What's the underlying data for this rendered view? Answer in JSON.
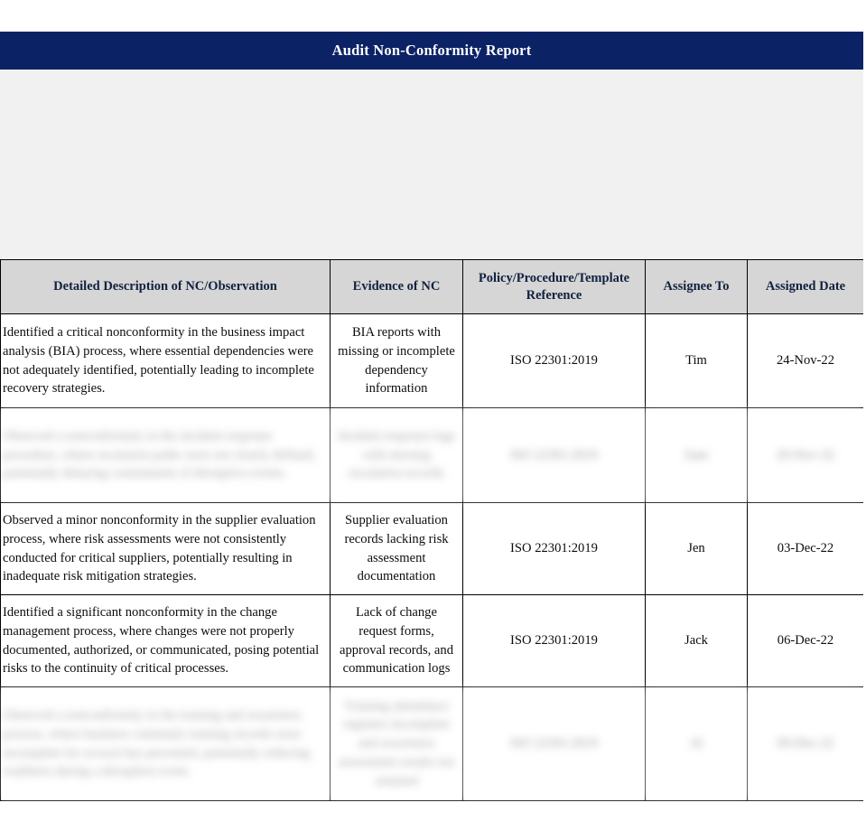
{
  "document": {
    "title": "Audit Non-Conformity Report",
    "banner_color": "#0b2265",
    "banner_text_color": "#ffffff",
    "header_fill": "#d6d6d6",
    "page_background": "#ffffff",
    "spacer_fill": "#f1f1f1"
  },
  "table": {
    "columns": [
      {
        "key": "description",
        "label": "Detailed Description of NC/Observation"
      },
      {
        "key": "evidence",
        "label": "Evidence of NC"
      },
      {
        "key": "policy",
        "label": "Policy/Procedure/Template Reference"
      },
      {
        "key": "assignee",
        "label": "Assignee To"
      },
      {
        "key": "assigned_date",
        "label": "Assigned Date"
      }
    ],
    "rows": [
      {
        "redacted": false,
        "description": "Identified a critical nonconformity in the business impact analysis (BIA) process, where essential dependencies were not adequately identified, potentially leading to incomplete recovery strategies.",
        "evidence": "BIA reports with missing or incomplete dependency information",
        "policy": "ISO 22301:2019",
        "assignee": "Tim",
        "assigned_date": "24-Nov-22"
      },
      {
        "redacted": true,
        "description": "Observed a nonconformity in the incident response procedure, where escalation paths were not clearly defined, potentially delaying containment of disruptive events.",
        "evidence": "Incident response logs with missing escalation records",
        "policy": "ISO 22301:2019",
        "assignee": "Sam",
        "assigned_date": "29-Nov-22"
      },
      {
        "redacted": false,
        "description": "Observed a minor nonconformity in the supplier evaluation process, where risk assessments were not consistently conducted for critical suppliers, potentially resulting in inadequate risk mitigation strategies.",
        "evidence": "Supplier evaluation records lacking risk assessment documentation",
        "policy": "ISO 22301:2019",
        "assignee": "Jen",
        "assigned_date": "03-Dec-22"
      },
      {
        "redacted": false,
        "description": "Identified a significant nonconformity in the change management process, where changes were not properly documented, authorized, or communicated, posing potential risks to the continuity of critical processes.",
        "evidence": "Lack of change request forms, approval records, and communication logs",
        "policy": "ISO 22301:2019",
        "assignee": "Jack",
        "assigned_date": "06-Dec-22"
      },
      {
        "redacted": true,
        "description": "Observed a nonconformity in the training and awareness process, where business continuity training records were incomplete for several key personnel, potentially reducing readiness during a disruption event.",
        "evidence": "Training attendance registers incomplete and awareness assessment results not retained",
        "policy": "ISO 22301:2019",
        "assignee": "Al",
        "assigned_date": "09-Dec-22"
      }
    ]
  }
}
